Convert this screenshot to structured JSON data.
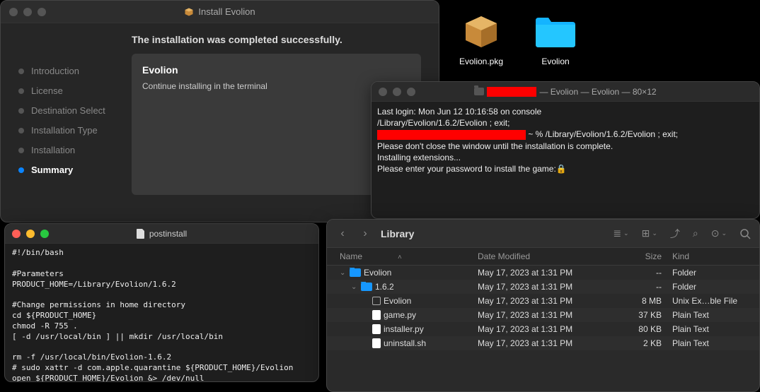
{
  "desktop": {
    "pkg_label": "Evolion.pkg",
    "folder_label": "Evolion"
  },
  "installer": {
    "title": "Install Evolion",
    "headline": "The installation was completed successfully.",
    "panel_title": "Evolion",
    "panel_text": "Continue installing in the terminal",
    "steps": {
      "intro": "Introduction",
      "license": "License",
      "dest": "Destination Select",
      "type": "Installation Type",
      "install": "Installation",
      "summary": "Summary"
    }
  },
  "terminal": {
    "title_suffix": " — Evolion — Evolion — 80×12",
    "line1": "Last login: Mon Jun 12 10:16:58 on console",
    "line2": "/Library/Evolion/1.6.2/Evolion ; exit;",
    "line3_suffix": " ~ % /Library/Evolion/1.6.2/Evolion ; exit;",
    "line4": "Please don't close the window until the installation is complete.",
    "line5": "Installing extensions...",
    "line6": "Please enter your password to install the game:🔒"
  },
  "editor": {
    "title": "postinstall",
    "content": "#!/bin/bash\n\n#Parameters\nPRODUCT_HOME=/Library/Evolion/1.6.2\n\n#Change permissions in home directory\ncd ${PRODUCT_HOME}\nchmod -R 755 .\n[ -d /usr/local/bin ] || mkdir /usr/local/bin\n\nrm -f /usr/local/bin/Evolion-1.6.2\n# sudo xattr -d com.apple.quarantine ${PRODUCT_HOME}/Evolion\nopen ${PRODUCT_HOME}/Evolion &> /dev/null"
  },
  "finder": {
    "location": "Library",
    "columns": {
      "name": "Name",
      "date": "Date Modified",
      "size": "Size",
      "kind": "Kind"
    },
    "rows": [
      {
        "indent": 0,
        "disclosure": "down",
        "icon": "folder",
        "name": "Evolion",
        "date": "May 17, 2023 at 1:31 PM",
        "size": "--",
        "kind": "Folder"
      },
      {
        "indent": 1,
        "disclosure": "down",
        "icon": "folder",
        "name": "1.6.2",
        "date": "May 17, 2023 at 1:31 PM",
        "size": "--",
        "kind": "Folder"
      },
      {
        "indent": 2,
        "disclosure": "",
        "icon": "exec",
        "name": "Evolion",
        "date": "May 17, 2023 at 1:31 PM",
        "size": "8 MB",
        "kind": "Unix Ex…ble File"
      },
      {
        "indent": 2,
        "disclosure": "",
        "icon": "doc",
        "name": "game.py",
        "date": "May 17, 2023 at 1:31 PM",
        "size": "37 KB",
        "kind": "Plain Text"
      },
      {
        "indent": 2,
        "disclosure": "",
        "icon": "doc",
        "name": "installer.py",
        "date": "May 17, 2023 at 1:31 PM",
        "size": "80 KB",
        "kind": "Plain Text"
      },
      {
        "indent": 2,
        "disclosure": "",
        "icon": "doc",
        "name": "uninstall.sh",
        "date": "May 17, 2023 at 1:31 PM",
        "size": "2 KB",
        "kind": "Plain Text"
      }
    ]
  }
}
